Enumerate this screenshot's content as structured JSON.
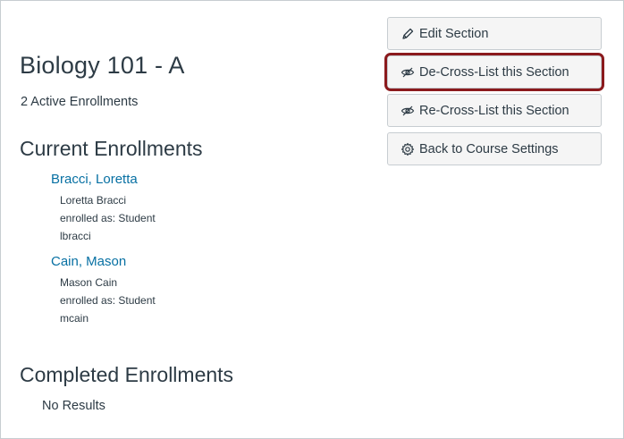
{
  "section": {
    "title": "Biology 101 - A",
    "active_enrollments": "2 Active Enrollments"
  },
  "current": {
    "heading": "Current Enrollments",
    "enrollments": [
      {
        "link": "Bracci, Loretta",
        "name": "Loretta Bracci",
        "role": "enrolled as: Student",
        "login": "lbracci"
      },
      {
        "link": "Cain, Mason",
        "name": "Mason Cain",
        "role": "enrolled as: Student",
        "login": "mcain"
      }
    ]
  },
  "completed": {
    "heading": "Completed Enrollments",
    "empty_text": "No Results"
  },
  "sidebar": {
    "buttons": [
      {
        "label": "Edit Section",
        "icon": "pencil-icon"
      },
      {
        "label": "De-Cross-List this Section",
        "icon": "eye-slash-icon"
      },
      {
        "label": "Re-Cross-List this Section",
        "icon": "eye-slash-icon"
      },
      {
        "label": "Back to Course Settings",
        "icon": "gear-icon"
      }
    ]
  },
  "colors": {
    "link": "#0770a3",
    "text": "#2d3b45",
    "highlight": "#8b1a1d",
    "button_bg": "#f5f5f5"
  }
}
